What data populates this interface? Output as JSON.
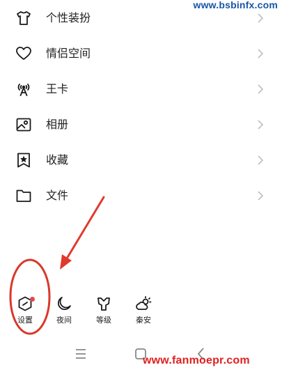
{
  "watermarks": {
    "top": "www.bsbinfx.com",
    "bottom": "www.fanmoepr.com"
  },
  "menu": {
    "items": [
      {
        "label": "个性装扮",
        "icon": "tshirt-icon"
      },
      {
        "label": "情侣空间",
        "icon": "heart-icon"
      },
      {
        "label": "王卡",
        "icon": "signal-tower-icon"
      },
      {
        "label": "相册",
        "icon": "photo-album-icon"
      },
      {
        "label": "收藏",
        "icon": "bookmark-star-icon"
      },
      {
        "label": "文件",
        "icon": "folder-icon"
      }
    ]
  },
  "toolbar": {
    "items": [
      {
        "label": "设置",
        "icon": "settings-icon",
        "badge": true
      },
      {
        "label": "夜间",
        "icon": "moon-icon"
      },
      {
        "label": "等级",
        "icon": "crown-icon"
      },
      {
        "label": "秦安",
        "icon": "weather-sun-cloud-icon"
      }
    ]
  },
  "system_nav": {
    "icons": [
      "menu-icon",
      "home-icon",
      "back-icon"
    ]
  },
  "colors": {
    "annotation": "#e03a2c",
    "badge": "#e24a4a",
    "watermark_top": "#1656a8",
    "watermark_bottom": "#e02020"
  }
}
